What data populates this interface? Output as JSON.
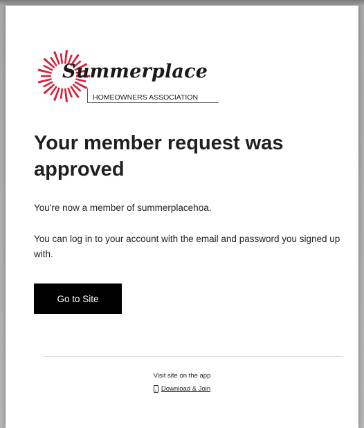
{
  "logo": {
    "wordmark": "Summerplace",
    "subtitle": "HOMEOWNERS ASSOCIATION",
    "ray_color": "#d9233c"
  },
  "email": {
    "heading": "Your member request was approved",
    "line1": "You're now a member of summerplacehoa.",
    "line2": "You can log in to your account with the email and password you signed up with.",
    "cta_label": "Go to Site"
  },
  "footer": {
    "note": "Visit site on the app",
    "link_label": "Download & Join",
    "link_icon": "phone-icon"
  }
}
